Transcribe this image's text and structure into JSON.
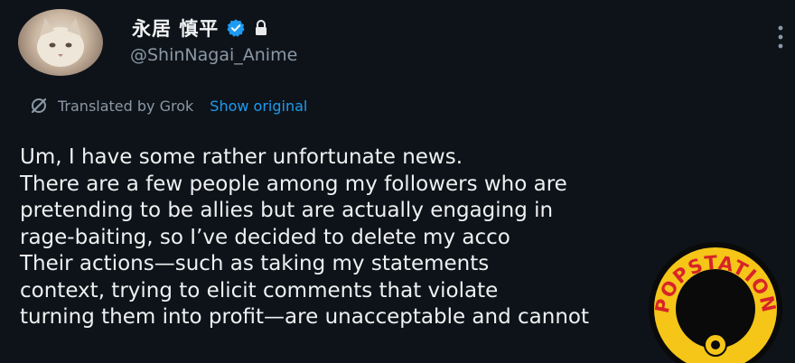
{
  "author": {
    "display_name": "永居 慎平",
    "handle": "@ShinNagai_Anime",
    "verified": true,
    "protected": true,
    "avatar_icon": "cat-avatar"
  },
  "translation": {
    "label": "Translated by Grok",
    "show_original": "Show original"
  },
  "post_lines": [
    "Um, I have some rather unfortunate news.",
    "There are a few people among my followers who are",
    "pretending to be allies but are actually engaging in",
    "rage-baiting, so I’ve decided to delete my acco",
    "Their actions—such as taking my statements",
    "context, trying to elicit comments that violate",
    "turning them into profit—are unacceptable and cannot"
  ],
  "watermark": {
    "text": "POPSTATION"
  },
  "colors": {
    "background": "#0e1319",
    "link": "#1d9bf0",
    "verified_badge": "#1d9bf0",
    "muted_text": "#8b98a5",
    "logo_yellow": "#f5c518",
    "logo_red": "#d8232a"
  }
}
